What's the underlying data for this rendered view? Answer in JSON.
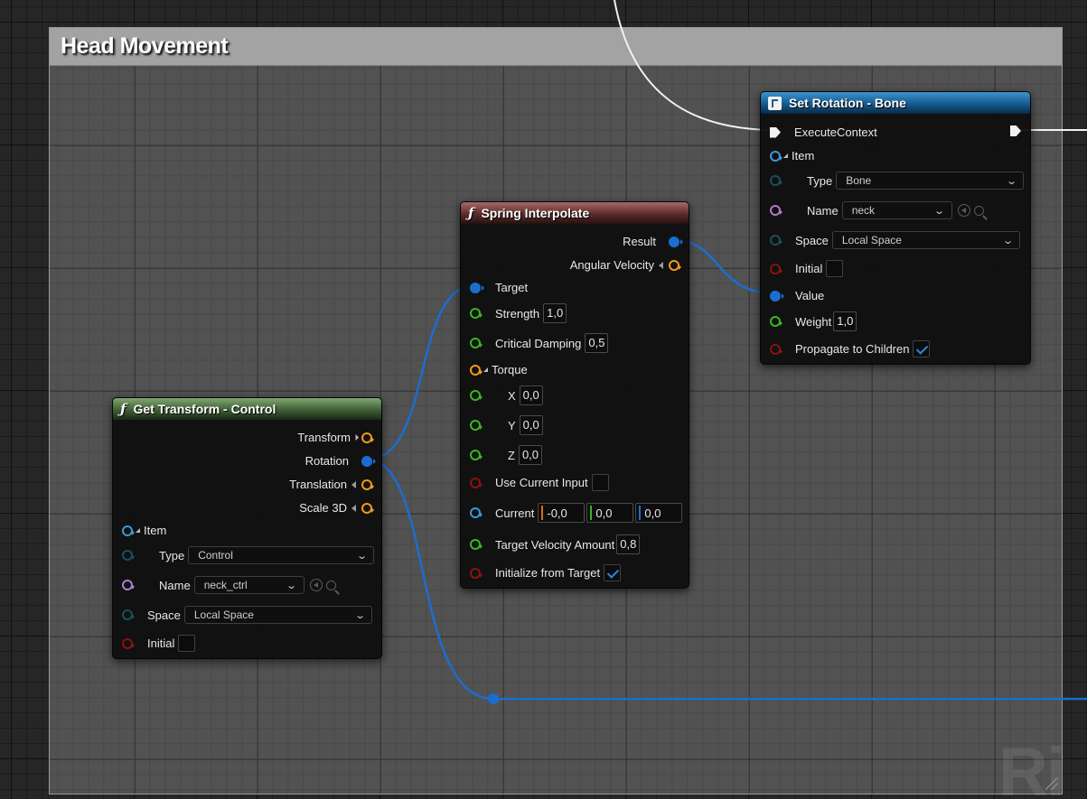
{
  "comment": {
    "title": "Head Movement",
    "watermark": "Ri"
  },
  "colors": {
    "wire_exec": "#f2f2f2",
    "wire_rotation": "#1b6ed0",
    "pin_float": "#37b81f",
    "pin_struct": "#f39a1c",
    "pin_bool": "#8a1212",
    "pin_name": "#b27ac9"
  },
  "get_transform": {
    "title": "Get Transform - Control",
    "icon": "function-icon",
    "outputs": {
      "transform": "Transform",
      "rotation": "Rotation",
      "translation": "Translation",
      "scale3d": "Scale 3D"
    },
    "item_label": "Item",
    "type_label": "Type",
    "type_value": "Control",
    "name_label": "Name",
    "name_value": "neck_ctrl",
    "space_label": "Space",
    "space_value": "Local Space",
    "initial_label": "Initial",
    "initial_checked": false
  },
  "spring": {
    "title": "Spring Interpolate",
    "icon": "function-icon",
    "result_label": "Result",
    "angular_velocity_label": "Angular Velocity",
    "target_label": "Target",
    "strength_label": "Strength",
    "strength_value": "1,0",
    "critical_damping_label": "Critical Damping",
    "critical_damping_value": "0,5",
    "torque_label": "Torque",
    "x_label": "X",
    "x_value": "0,0",
    "y_label": "Y",
    "y_value": "0,0",
    "z_label": "Z",
    "z_value": "0,0",
    "use_current_input_label": "Use Current Input",
    "use_current_input_checked": false,
    "current_label": "Current",
    "current_values": [
      "-0,0",
      "0,0",
      "0,0"
    ],
    "target_velocity_label": "Target Velocity Amount",
    "target_velocity_value": "0,8",
    "initialize_label": "Initialize from Target",
    "initialize_checked": true
  },
  "set_rotation": {
    "title": "Set Rotation - Bone",
    "icon": "set-node-icon",
    "exec_label": "ExecuteContext",
    "item_label": "Item",
    "type_label": "Type",
    "type_value": "Bone",
    "name_label": "Name",
    "name_value": "neck",
    "space_label": "Space",
    "space_value": "Local Space",
    "initial_label": "Initial",
    "initial_checked": false,
    "value_label": "Value",
    "weight_label": "Weight",
    "weight_value": "1,0",
    "propagate_label": "Propagate to Children",
    "propagate_checked": true
  }
}
